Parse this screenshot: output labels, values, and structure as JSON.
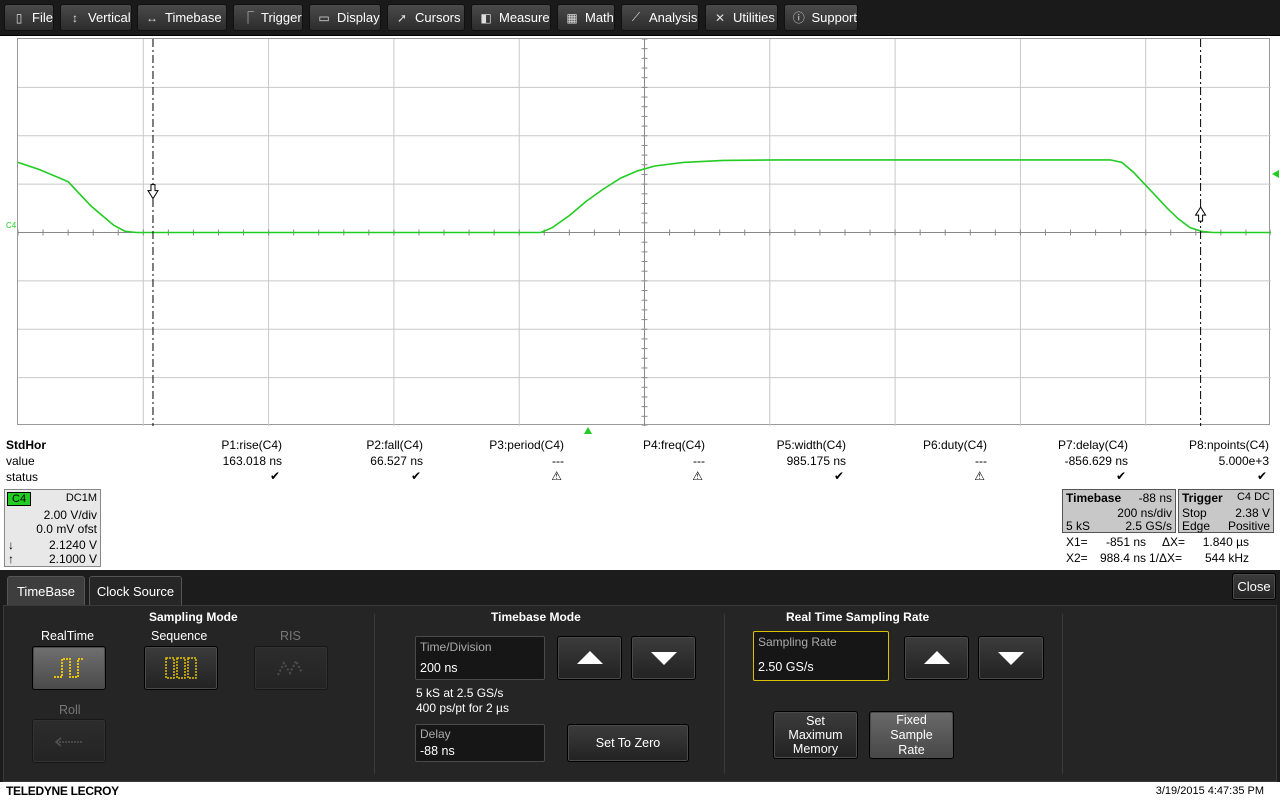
{
  "menu": {
    "file": "File",
    "vertical": "Vertical",
    "timebase": "Timebase",
    "trigger": "Trigger",
    "display": "Display",
    "cursors": "Cursors",
    "measure": "Measure",
    "math": "Math",
    "analysis": "Analysis",
    "utilities": "Utilities",
    "support": "Support"
  },
  "icons": {
    "file": "file-icon",
    "vertical": "vertical-arrows-icon",
    "timebase": "horizontal-arrows-icon",
    "trigger": "trigger-icon",
    "display": "display-icon",
    "cursors": "cursor-icon",
    "measure": "measure-icon",
    "math": "math-icon",
    "analysis": "analysis-icon",
    "utilities": "utilities-icon",
    "support": "info-icon"
  },
  "waveform": {
    "channel_label": "C4",
    "color": "#22cc22",
    "points_ns": [
      [
        -1088,
        2.9
      ],
      [
        -1050,
        2.6
      ],
      [
        -1000,
        2.1
      ],
      [
        -980,
        1.6
      ],
      [
        -960,
        1.1
      ],
      [
        -940,
        0.7
      ],
      [
        -920,
        0.3
      ],
      [
        -900,
        0.05
      ],
      [
        -880,
        0
      ],
      [
        -170,
        0
      ],
      [
        -150,
        0.2
      ],
      [
        -120,
        0.7
      ],
      [
        -90,
        1.3
      ],
      [
        -60,
        1.8
      ],
      [
        -30,
        2.25
      ],
      [
        0,
        2.55
      ],
      [
        30,
        2.75
      ],
      [
        80,
        2.9
      ],
      [
        150,
        2.98
      ],
      [
        250,
        3.0
      ],
      [
        830,
        3.0
      ],
      [
        850,
        2.9
      ],
      [
        870,
        2.5
      ],
      [
        890,
        2.0
      ],
      [
        910,
        1.5
      ],
      [
        930,
        1.0
      ],
      [
        950,
        0.55
      ],
      [
        970,
        0.2
      ],
      [
        990,
        0.05
      ],
      [
        1010,
        0
      ],
      [
        1112,
        0
      ]
    ],
    "x_range_ns": [
      -1088,
      1112
    ],
    "y_range_v": [
      -8,
      8
    ]
  },
  "measurements": {
    "row_label": "StdHor",
    "value_label": "value",
    "status_label": "status",
    "params": [
      {
        "name": "P1:rise(C4)",
        "value": "163.018 ns",
        "status": "ok"
      },
      {
        "name": "P2:fall(C4)",
        "value": "66.527 ns",
        "status": "ok"
      },
      {
        "name": "P3:period(C4)",
        "value": "---",
        "status": "warn"
      },
      {
        "name": "P4:freq(C4)",
        "value": "---",
        "status": "warn"
      },
      {
        "name": "P5:width(C4)",
        "value": "985.175 ns",
        "status": "ok"
      },
      {
        "name": "P6:duty(C4)",
        "value": "---",
        "status": "warn"
      },
      {
        "name": "P7:delay(C4)",
        "value": "-856.629 ns",
        "status": "ok"
      },
      {
        "name": "P8:npoints(C4)",
        "value": "5.000e+3",
        "status": "ok"
      }
    ],
    "status_glyphs": {
      "ok": "✔",
      "warn": "⚠"
    }
  },
  "channel": {
    "name": "C4",
    "coupling": "DC1M",
    "vdiv": "2.00 V/div",
    "offset": "0.0 mV ofst",
    "cursor1": "2.1240 V",
    "cursor2": "2.1000 V",
    "cursor1_symbol": "↓",
    "cursor2_symbol": "↑"
  },
  "timebase_box": {
    "title": "Timebase",
    "delay": "-88 ns",
    "div": "200 ns/div",
    "samples": "5 kS",
    "rate": "2.5 GS/s"
  },
  "trigger_box": {
    "title": "Trigger",
    "source": "C4 DC",
    "mode": "Stop",
    "level": "2.38 V",
    "type": "Edge",
    "slope": "Positive"
  },
  "cursors": {
    "x1_label": "X1=",
    "x1": "-851 ns",
    "dx_label": "ΔX=",
    "dx": "1.840 µs",
    "x2_label": "X2=",
    "x2": "988.4 ns",
    "inv_label": "1/ΔX=",
    "inv": "544 kHz",
    "x1_ns": -851,
    "x2_ns": 988.4
  },
  "dialog": {
    "tabs": [
      "TimeBase",
      "Clock Source"
    ],
    "close": "Close",
    "sampling_mode": {
      "title": "Sampling Mode",
      "realtime": "RealTime",
      "sequence": "Sequence",
      "ris": "RIS",
      "roll": "Roll"
    },
    "timebase_mode": {
      "title": "Timebase Mode",
      "time_div_label": "Time/Division",
      "time_div_value": "200 ns",
      "info1": "5 kS at 2.5 GS/s",
      "info2": "400 ps/pt for 2 µs",
      "delay_label": "Delay",
      "delay_value": "-88 ns",
      "set_zero": "Set To Zero"
    },
    "rate": {
      "title": "Real Time Sampling Rate",
      "label": "Sampling Rate",
      "value": "2.50 GS/s",
      "set_max": "Set Maximum Memory",
      "fixed": "Fixed Sample Rate"
    }
  },
  "footer": {
    "brand": "TELEDYNE LECROY",
    "datetime": "3/19/2015 4:47:35 PM"
  }
}
